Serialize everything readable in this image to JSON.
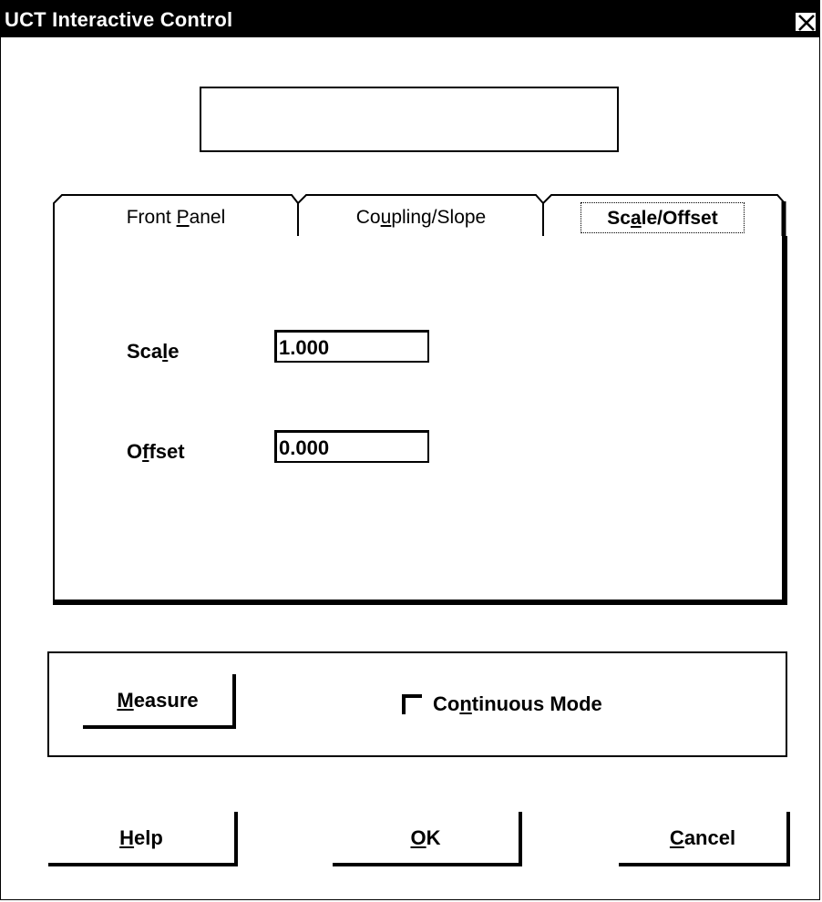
{
  "window": {
    "title": "UCT Interactive Control",
    "close_icon": "close-icon"
  },
  "display": {
    "value": ""
  },
  "tabs": [
    {
      "label_pre": "Front ",
      "label_u": "P",
      "label_post": "anel",
      "active": false
    },
    {
      "label_pre": "Co",
      "label_u": "u",
      "label_post": "pling/Slope",
      "active": false
    },
    {
      "label_pre": "Sc",
      "label_u": "a",
      "label_post": "le/Offset",
      "active": true
    }
  ],
  "scale": {
    "label_pre": "Sca",
    "label_u": "l",
    "label_post": "e",
    "value": "1.000"
  },
  "offset": {
    "label_pre": "O",
    "label_u": "f",
    "label_post": "fset",
    "value": "0.000"
  },
  "measure": {
    "label_u": "M",
    "label_post": "easure"
  },
  "continuous": {
    "label_pre": "Co",
    "label_u": "n",
    "label_post": "tinuous Mode",
    "checked": false
  },
  "buttons": {
    "help": {
      "label_u": "H",
      "label_post": "elp"
    },
    "ok": {
      "label_u": "O",
      "label_post": "K"
    },
    "cancel": {
      "label_u": "C",
      "label_post": "ancel"
    }
  }
}
